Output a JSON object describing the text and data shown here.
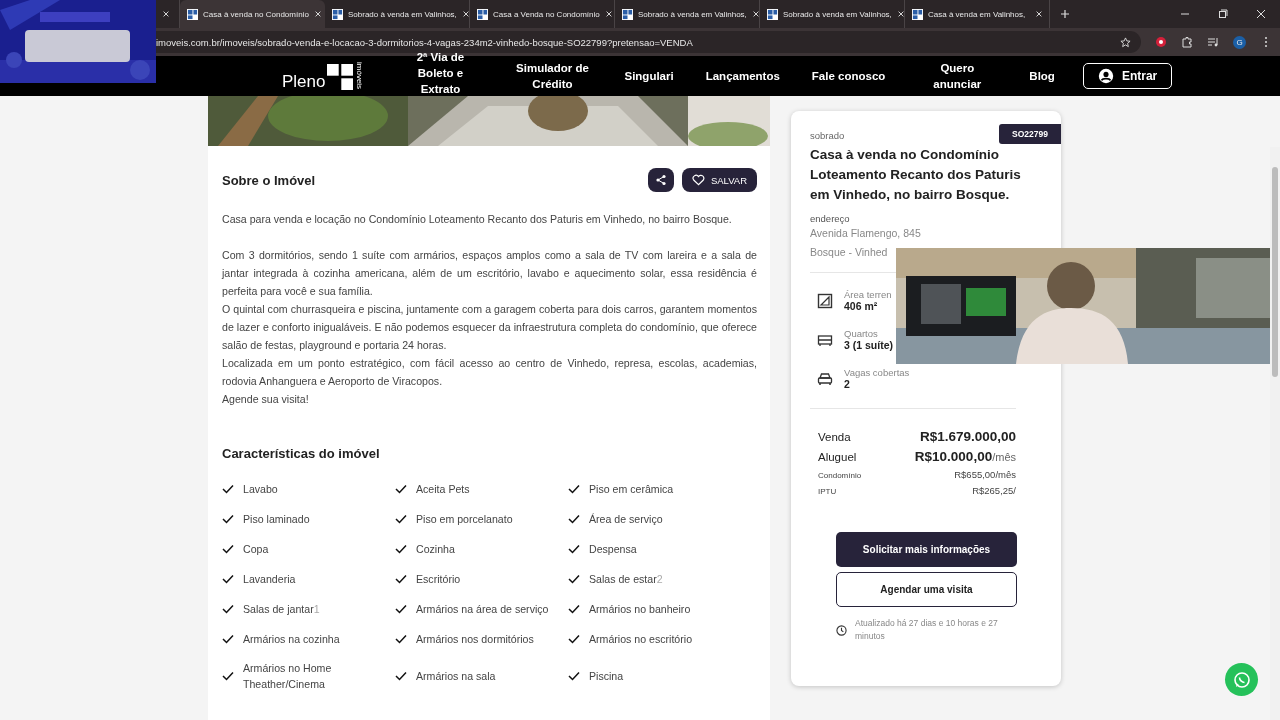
{
  "browser": {
    "tabs": [
      {
        "selected": false
      },
      {
        "title": "Casa à venda no Condomínio",
        "selected": true
      },
      {
        "title": "Sobrado à venda em Valinhos,",
        "selected": false
      },
      {
        "title": "Casa a Venda no Condomínio",
        "selected": false
      },
      {
        "title": "Sobrado à venda em Valinhos,",
        "selected": false
      },
      {
        "title": "Sobrado à venda em Valinhos,",
        "selected": false
      },
      {
        "title": "Casa à venda em Valinhos,",
        "selected": false
      }
    ],
    "url": "imoveis.com.br/imoveis/sobrado-venda-e-locacao-3-dormitorios-4-vagas-234m2-vinhedo-bosque-SO22799?pretensao=VENDA",
    "profile": "G"
  },
  "site_nav": {
    "logo": "Pleno",
    "logo_sub": "imóveis",
    "links": [
      "2ª Via de Boleto e Extrato",
      "Simulador de Crédito",
      "Singulari",
      "Lançamentos",
      "Fale conosco",
      "Quero anunciar",
      "Blog"
    ],
    "login": "Entrar"
  },
  "about": {
    "title": "Sobre o Imóvel",
    "save": "SALVAR",
    "paragraphs": [
      "Casa para venda e locação no Condomínio Loteamento Recanto dos Paturis em Vinhedo, no bairro Bosque.",
      "Com 3 dormitórios, sendo 1 suíte com armários, espaços amplos como a sala de TV com lareira e a sala de jantar integrada à cozinha americana, além de um escritório, lavabo e aquecimento solar, essa residência é perfeita para você e sua família.",
      "O quintal com churrasqueira e piscina, juntamente com a garagem coberta para dois carros, garantem momentos de lazer e conforto inigualáveis. E não podemos esquecer da infraestrutura completa do condomínio, que oferece salão de festas, playground e portaria 24 horas.",
      "Localizada em um ponto estratégico, com fácil acesso ao centro de Vinhedo, represa, escolas, academias, rodovia Anhanguera e Aeroporto de Viracopos.",
      "Agende sua visita!"
    ]
  },
  "features": {
    "title": "Características do imóvel",
    "items": [
      {
        "label": "Lavabo"
      },
      {
        "label": "Aceita Pets"
      },
      {
        "label": "Piso em cerâmica"
      },
      {
        "label": "Piso laminado"
      },
      {
        "label": "Piso em porcelanato"
      },
      {
        "label": "Área de serviço"
      },
      {
        "label": "Copa"
      },
      {
        "label": "Cozinha"
      },
      {
        "label": "Despensa"
      },
      {
        "label": "Lavanderia"
      },
      {
        "label": "Escritório"
      },
      {
        "label": "Salas de estar",
        "count": "2"
      },
      {
        "label": "Salas de jantar",
        "count": "1"
      },
      {
        "label": "Armários na área de serviço"
      },
      {
        "label": "Armários no banheiro"
      },
      {
        "label": "Armários na cozinha"
      },
      {
        "label": "Armários nos dormitórios"
      },
      {
        "label": "Armários no escritório"
      },
      {
        "label": "Armários no Home Theather/Cinema"
      },
      {
        "label": "Armários na sala"
      },
      {
        "label": "Piscina"
      }
    ]
  },
  "card": {
    "type": "sobrado",
    "code": "SO22799",
    "title": "Casa à venda no Condomínio Loteamento Recanto dos Paturis em Vinhedo, no bairro Bosque.",
    "address_label": "endereço",
    "address": "Avenida Flamengo, 845",
    "district": "Bosque - Vinhed",
    "specs": [
      {
        "kind": "area",
        "label": "Área terren",
        "value": "406 m²"
      },
      {
        "kind": "bed",
        "label": "Quartos",
        "value": "3 (1 suíte)"
      },
      {
        "kind": "car",
        "label": "Vagas cobertas",
        "value": "2"
      }
    ],
    "prices": [
      {
        "kind": "big",
        "label": "Venda",
        "value": "R$1.679.000,00"
      },
      {
        "kind": "big",
        "label": "Aluguel",
        "value": "R$10.000,00",
        "unit": "/mês"
      },
      {
        "kind": "small",
        "label": "Condomínio",
        "value": "R$655,00/mês"
      },
      {
        "kind": "small",
        "label": "IPTU",
        "value": "R$265,25/"
      }
    ],
    "primary_button": "Solicitar mais informações",
    "secondary_button": "Agendar uma visita",
    "updated": "Atualizado há 27 dias e 10 horas e 27 minutos"
  }
}
